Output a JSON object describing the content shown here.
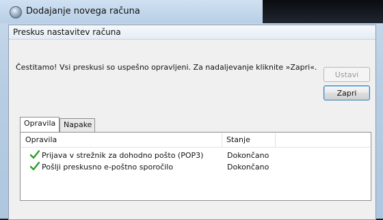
{
  "window": {
    "title": "Dodajanje novega računa"
  },
  "dialog": {
    "title": "Preskus nastavitev računa",
    "message": "Čestitamo! Vsi preskusi so uspešno opravljeni. Za nadaljevanje kliknite »Zapri«.",
    "buttons": {
      "stop_label": "Ustavi",
      "close_label": "Zapri"
    }
  },
  "tabs": [
    {
      "label": "Opravila",
      "active": true
    },
    {
      "label": "Napake",
      "active": false
    }
  ],
  "table": {
    "columns": [
      "Opravila",
      "Stanje"
    ],
    "rows": [
      {
        "task": "Prijava v strežnik za dohodno pošto (POP3)",
        "status": "Dokončano",
        "icon": "checkmark-icon"
      },
      {
        "task": "Pošlji preskusno e-poštno sporočilo",
        "status": "Dokončano",
        "icon": "checkmark-icon"
      }
    ]
  },
  "colors": {
    "check_green": "#2e9b2a",
    "default_button_border": "#3c7fb1"
  }
}
